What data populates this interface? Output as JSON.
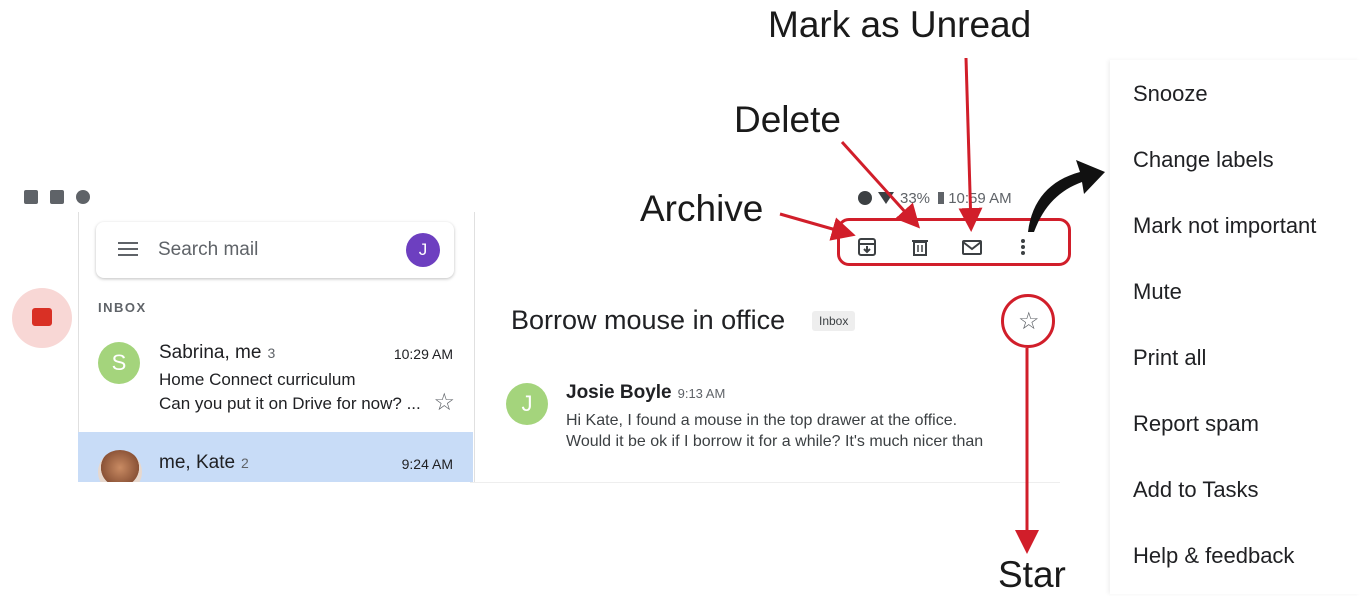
{
  "search": {
    "placeholder": "Search mail",
    "avatar_letter": "J"
  },
  "inbox_label": "INBOX",
  "conversations": [
    {
      "avatar_letter": "S",
      "sender": "Sabrina, me",
      "count": "3",
      "time": "10:29 AM",
      "subject": "Home Connect curriculum",
      "snippet": "Can you put it on Drive for now? ..."
    },
    {
      "sender": "me, Kate",
      "count": "2",
      "time": "9:24 AM"
    }
  ],
  "status_bar": {
    "battery": "33%",
    "clock": "10:59 AM"
  },
  "thread": {
    "title": "Borrow mouse in office",
    "label_chip": "Inbox",
    "message": {
      "avatar_letter": "J",
      "sender": "Josie Boyle",
      "time": "9:13 AM",
      "line1": "Hi Kate, I found a mouse in the top drawer at the office.",
      "line2": "Would it be ok if I borrow it for a while? It's much nicer than"
    }
  },
  "annotations": {
    "mark_unread": "Mark as Unread",
    "delete": "Delete",
    "archive": "Archive",
    "star": "Star"
  },
  "overflow_menu": [
    "Snooze",
    "Change labels",
    "Mark not important",
    "Mute",
    "Print all",
    "Report spam",
    "Add to Tasks",
    "Help & feedback"
  ],
  "colors": {
    "annotation_red": "#d11e2a",
    "avatar_green": "#a4d47c",
    "avatar_purple": "#6d3fc0",
    "selected_row": "#c8dcf7"
  },
  "icons": [
    "calendar-icon",
    "image-icon",
    "cloud-icon",
    "menu-icon",
    "inbox-icon",
    "archive-icon",
    "trash-icon",
    "mail-icon",
    "more-vert-icon",
    "star-icon"
  ]
}
